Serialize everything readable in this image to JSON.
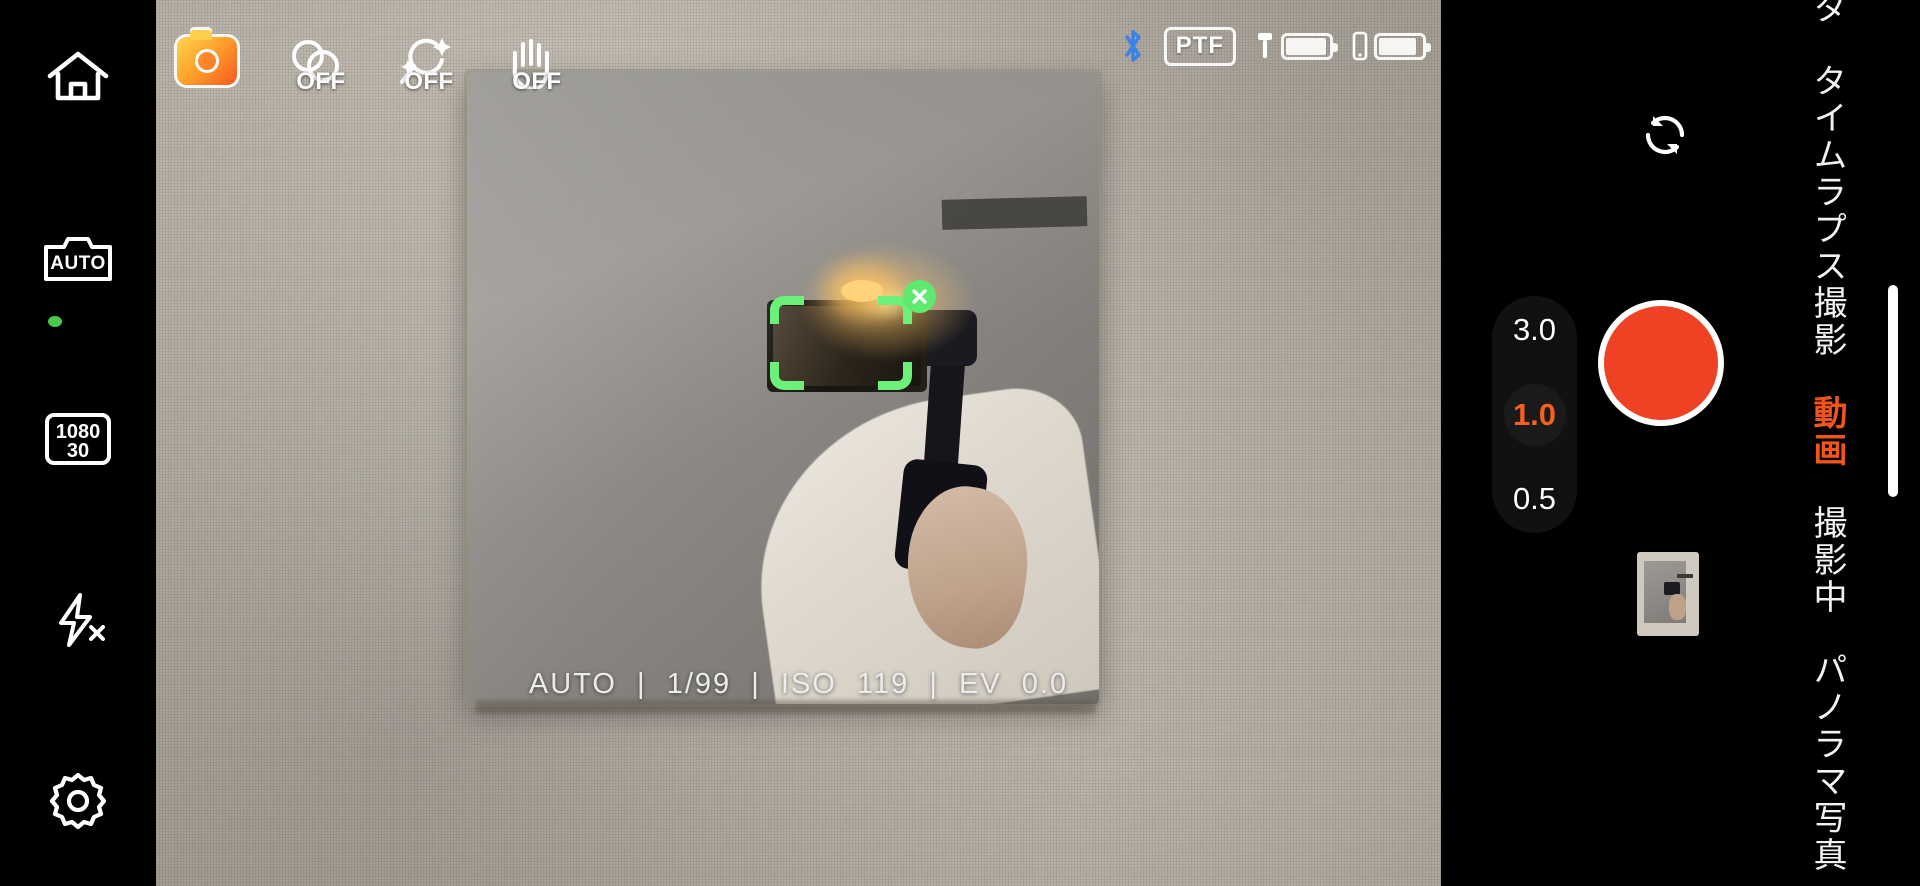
{
  "app": {
    "orientation": "landscape",
    "accent_orange": "#f2541b",
    "record_red": "#ef4123",
    "track_green": "#5fe96f",
    "bluetooth_blue": "#3b82e8"
  },
  "left_rail": {
    "items": [
      {
        "name": "home-icon",
        "label": "Home"
      },
      {
        "name": "auto-mode-icon",
        "label": "AUTO"
      },
      {
        "name": "resolution-icon",
        "label_top": "1080",
        "label_bottom": "30"
      },
      {
        "name": "flash-off-icon",
        "label": "Flash Off"
      },
      {
        "name": "settings-gear-icon",
        "label": "Settings"
      }
    ],
    "recording_dot_visible": true
  },
  "top_toolbar": {
    "items": [
      {
        "name": "camera-mode-icon",
        "state": ""
      },
      {
        "name": "hdr-icon",
        "state": "OFF"
      },
      {
        "name": "beauty-icon",
        "state": "OFF"
      },
      {
        "name": "gesture-icon",
        "state": "OFF"
      }
    ]
  },
  "status_bar": {
    "bluetooth_icon": "bluetooth-icon",
    "module_badge": "PTF",
    "gimbal_battery": {
      "icon": "gimbal-icon",
      "level_percent": 95
    },
    "phone_battery": {
      "icon": "phone-icon",
      "level_percent": 88
    }
  },
  "viewfinder": {
    "exposure_readout": "AUTO  |  1/99  |  ISO  119  |  EV  0.0",
    "exposure_parts": {
      "mode": "AUTO",
      "shutter": "1/99",
      "iso": "ISO 119",
      "ev": "EV 0.0"
    },
    "tracking_box": {
      "name": "subject-tracking-box",
      "close_label": "×",
      "active": true
    }
  },
  "zoom_slider": {
    "max_label": "3.0",
    "current_label": "1.0",
    "min_label": "0.5"
  },
  "right_controls": {
    "flip_camera_icon": "camera-flip-icon",
    "record_button_label": "Record",
    "thumbnail_label": "Last capture"
  },
  "mode_selector": {
    "items": [
      {
        "label": "パノラマ写真",
        "active": false
      },
      {
        "label": "撮影中",
        "active": false
      },
      {
        "label": "動画",
        "active": true
      },
      {
        "label": "タイムラプス撮影",
        "active": false
      },
      {
        "label": "動くタ",
        "active": false
      }
    ]
  }
}
